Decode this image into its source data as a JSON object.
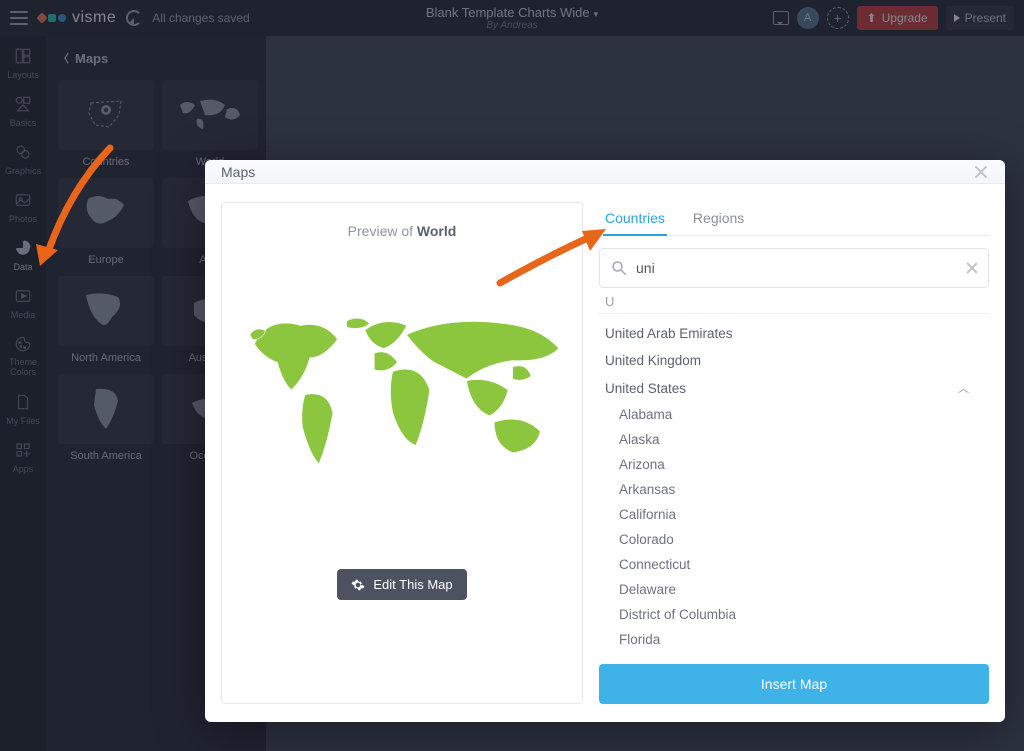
{
  "topbar": {
    "brand": "visme",
    "save_status": "All changes saved",
    "doc_title": "Blank Template Charts Wide",
    "doc_author": "By Andreas",
    "avatar_initial": "A",
    "upgrade_label": "Upgrade",
    "present_label": "Present"
  },
  "rail": {
    "items": [
      {
        "label": "Layouts"
      },
      {
        "label": "Basics"
      },
      {
        "label": "Graphics"
      },
      {
        "label": "Photos"
      },
      {
        "label": "Data"
      },
      {
        "label": "Media"
      },
      {
        "label": "Theme Colors"
      },
      {
        "label": "My Files"
      },
      {
        "label": "Apps"
      }
    ]
  },
  "sidepanel": {
    "title": "Maps",
    "thumbs": [
      "Countries",
      "World",
      "Europe",
      "Asia",
      "North America",
      "Australia",
      "South America",
      "Oceania"
    ]
  },
  "modal": {
    "title": "Maps",
    "preview_prefix": "Preview of ",
    "preview_name": "World",
    "edit_button": "Edit This Map",
    "tab_countries": "Countries",
    "tab_regions": "Regions",
    "search_value": "uni",
    "group_letter": "U",
    "countries": [
      {
        "name": "United Arab Emirates"
      },
      {
        "name": "United Kingdom"
      },
      {
        "name": "United States",
        "expanded": true
      }
    ],
    "us_states": [
      "Alabama",
      "Alaska",
      "Arizona",
      "Arkansas",
      "California",
      "Colorado",
      "Connecticut",
      "Delaware",
      "District of Columbia",
      "Florida"
    ],
    "insert_button": "Insert Map"
  }
}
